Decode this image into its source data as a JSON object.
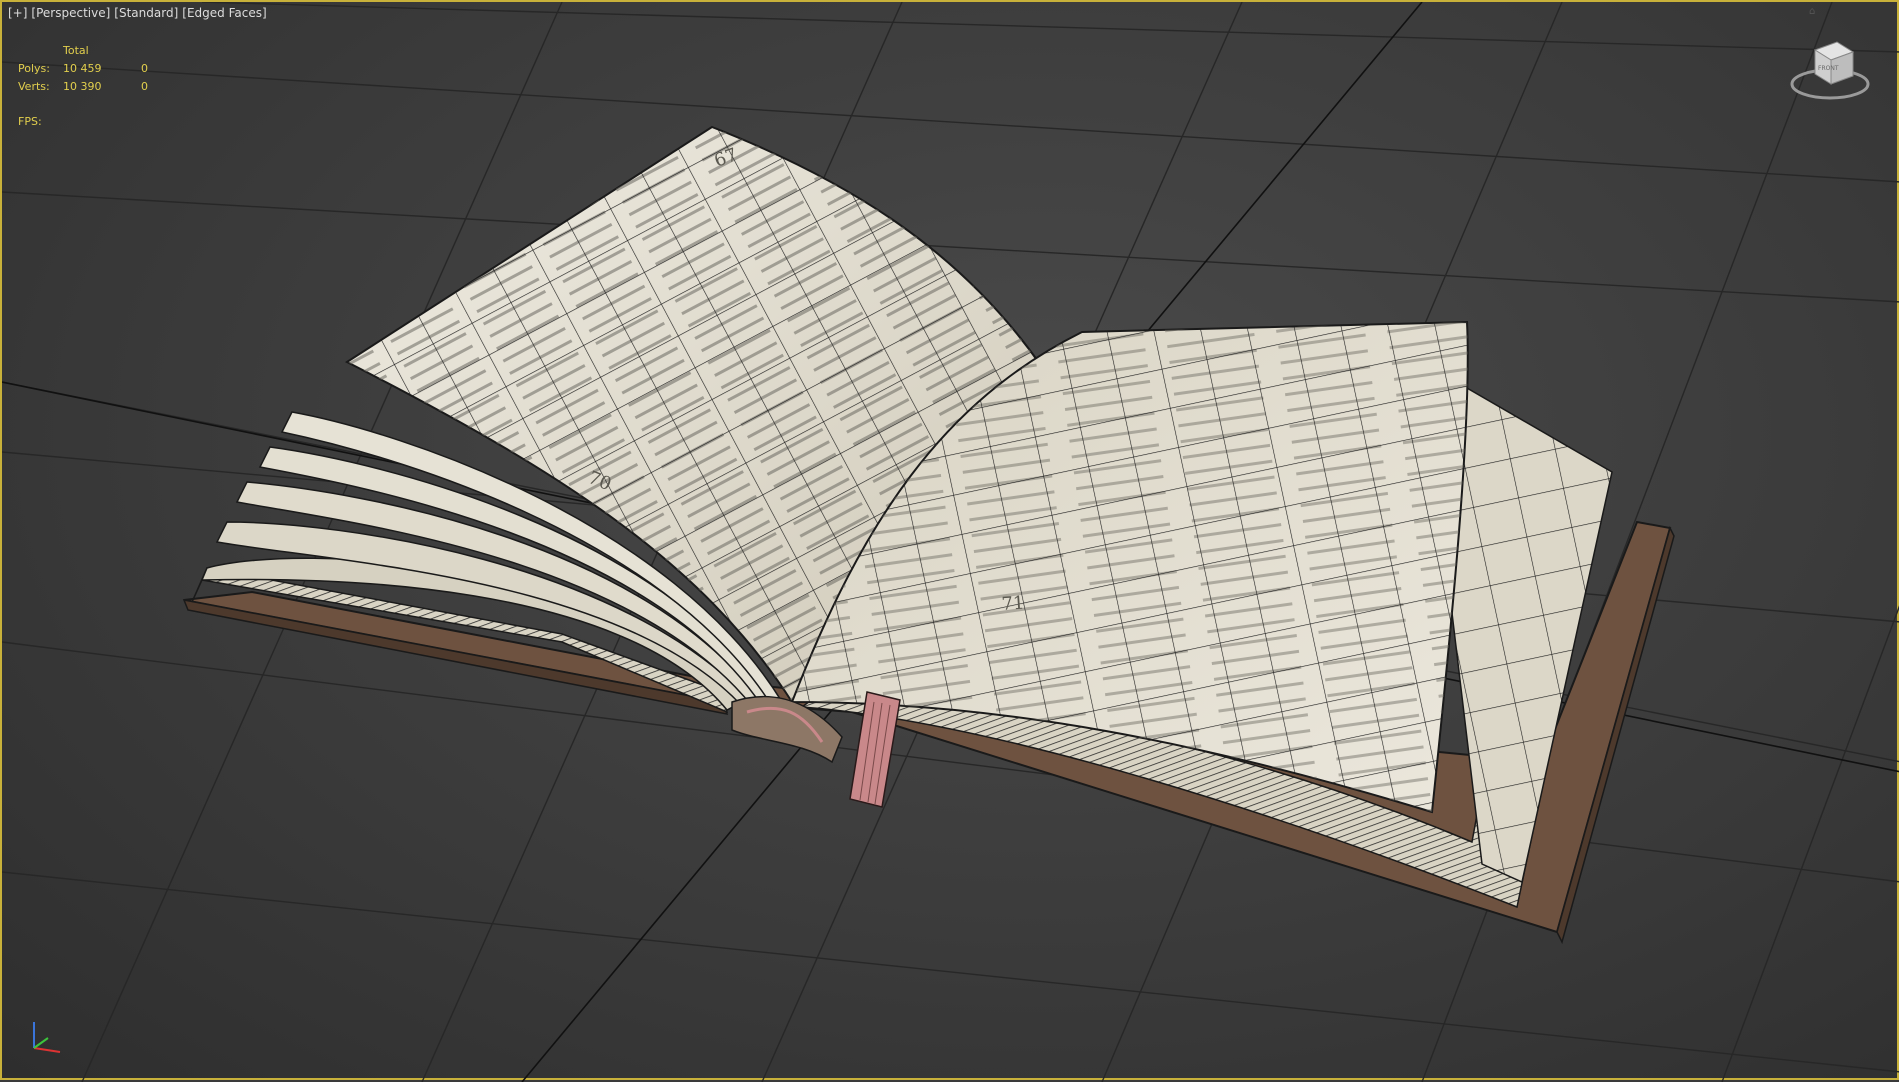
{
  "viewport": {
    "label_plus": "[+]",
    "label_view": "[Perspective]",
    "label_shading": "[Standard]",
    "label_edges": "[Edged Faces]"
  },
  "stats": {
    "header": "Total",
    "polys_label": "Polys:",
    "polys_total": "10 459",
    "polys_sel": "0",
    "verts_label": "Verts:",
    "verts_total": "10 390",
    "verts_sel": "0",
    "fps_label": "FPS:"
  },
  "viewcube": {
    "face_label": "FRONT"
  },
  "book": {
    "left_page_number": "70",
    "right_page_number": "71",
    "top_page_number": "67"
  },
  "colors": {
    "viewport_border": "#c8b13a",
    "stats_text": "#e2cf4d",
    "paper": "#e6e1d3",
    "cover": "#6e5240",
    "ribbon": "#c9888a",
    "grid": "#262626"
  }
}
